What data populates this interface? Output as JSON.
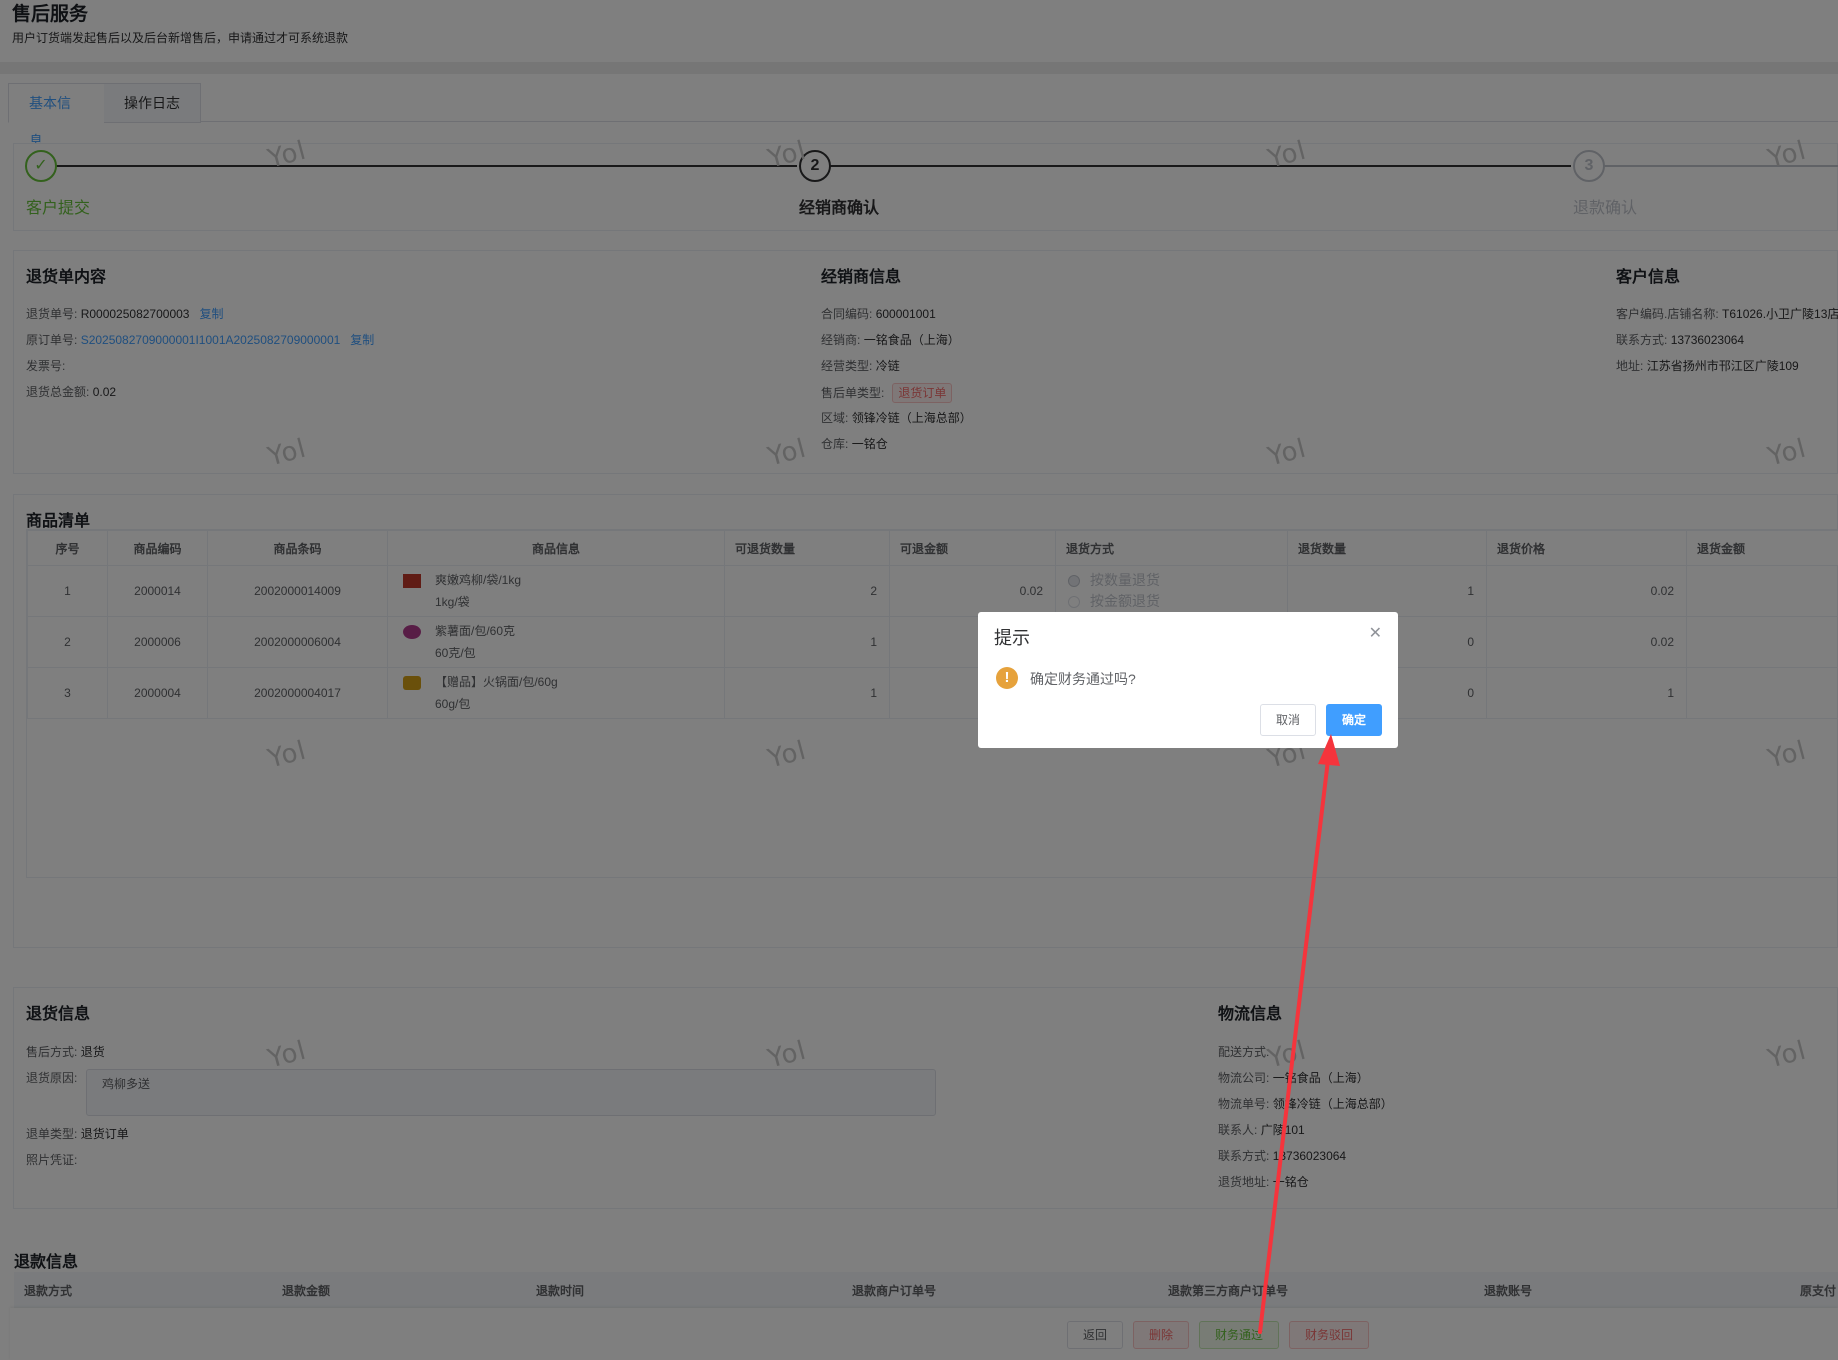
{
  "page": {
    "title": "售后服务",
    "subtitle": "用户订货端发起售后以及后台新增售后，申请通过才可系统退款"
  },
  "tabs": [
    {
      "label": "基本信息"
    },
    {
      "label": "操作日志"
    }
  ],
  "steps": [
    {
      "num": "✓",
      "label": "客户提交"
    },
    {
      "num": "2",
      "label": "经销商确认"
    },
    {
      "num": "3",
      "label": "退款确认"
    }
  ],
  "watermark": "Yol",
  "return_content": {
    "title": "退货单内容",
    "rows": [
      {
        "label": "退货单号:",
        "value": "R000025082700003",
        "link": "复制"
      },
      {
        "label": "原订单号:",
        "value": "S2025082709000001I1001A2025082709000001",
        "link": "复制"
      },
      {
        "label": "发票号:",
        "value": ""
      },
      {
        "label": "退货总金额:",
        "value": "0.02"
      }
    ]
  },
  "dealer": {
    "title": "经销商信息",
    "rows": [
      {
        "label": "合同编码:",
        "value": "600001001"
      },
      {
        "label": "经销商:",
        "value": "一铭食品（上海）"
      },
      {
        "label": "经营类型:",
        "value": "冷链"
      },
      {
        "label": "售后单类型:",
        "tag": "退货订单"
      },
      {
        "label": "区域:",
        "value": "领锋冷链（上海总部）"
      },
      {
        "label": "仓库:",
        "value": "一铭仓"
      }
    ]
  },
  "customer": {
    "title": "客户信息",
    "rows": [
      {
        "label": "客户编码.店铺名称:",
        "value": "T61026.小卫广陵13店"
      },
      {
        "label": "联系方式:",
        "value": "13736023064"
      },
      {
        "label": "地址:",
        "value": "江苏省扬州市邗江区广陵109"
      }
    ]
  },
  "goods": {
    "title": "商品清单",
    "headers": [
      "序号",
      "商品编码",
      "商品条码",
      "商品信息",
      "可退货数量",
      "可退金额",
      "退货方式",
      "退货数量",
      "退货价格",
      "退货金额"
    ],
    "rows": [
      {
        "no": "1",
        "code": "2000014",
        "barcode": "2002000014009",
        "name": "爽嫩鸡柳/袋/1kg",
        "spec": "1kg/袋",
        "qty": "2",
        "amount": "0.02",
        "ret_qty": "1",
        "price": "0.02",
        "icon_color": "#c0392b"
      },
      {
        "no": "2",
        "code": "2000006",
        "barcode": "2002000006004",
        "name": "紫薯面/包/60克",
        "spec": "60克/包",
        "qty": "1",
        "amount": "",
        "ret_qty": "0",
        "price": "0.02",
        "icon_color": "#b03a8c"
      },
      {
        "no": "3",
        "code": "2000004",
        "barcode": "2002000004017",
        "name": "【赠品】火锅面/包/60g",
        "spec": "60g/包",
        "qty": "1",
        "amount": "",
        "ret_qty": "0",
        "price": "1",
        "icon_color": "#d4a017"
      }
    ],
    "return_options": [
      "按数量退货",
      "按金额退货"
    ]
  },
  "return_info": {
    "title": "退货信息",
    "method_label": "售后方式:",
    "method": "退货",
    "reason_label": "退货原因:",
    "reason": "鸡柳多送",
    "type_label": "退单类型:",
    "type": "退货订单",
    "photo_label": "照片凭证:"
  },
  "logistics": {
    "title": "物流信息",
    "rows": [
      {
        "label": "配送方式:",
        "value": ""
      },
      {
        "label": "物流公司:",
        "value": "一铭食品（上海）"
      },
      {
        "label": "物流单号:",
        "value": "领锋冷链（上海总部）"
      },
      {
        "label": "联系人:",
        "value": "广陵101"
      },
      {
        "label": "联系方式:",
        "value": "13736023064"
      },
      {
        "label": "退货地址:",
        "value": "一铭仓"
      }
    ]
  },
  "refund": {
    "title": "退款信息",
    "headers": [
      "退款方式",
      "退款金额",
      "退款时间",
      "退款商户订单号",
      "退款第三方商户订单号",
      "退款账号",
      "原支付"
    ]
  },
  "actions": {
    "back": "返回",
    "delete": "删除",
    "finance_pass": "财务通过",
    "finance_reject": "财务驳回"
  },
  "dialog": {
    "title": "提示",
    "message": "确定财务通过吗?",
    "cancel": "取消",
    "confirm": "确定"
  },
  "colors": {
    "primary": "#409eff",
    "success": "#67c23a",
    "danger": "#f56c6c",
    "warning": "#e6a23c",
    "arrow": "#f5343c"
  }
}
